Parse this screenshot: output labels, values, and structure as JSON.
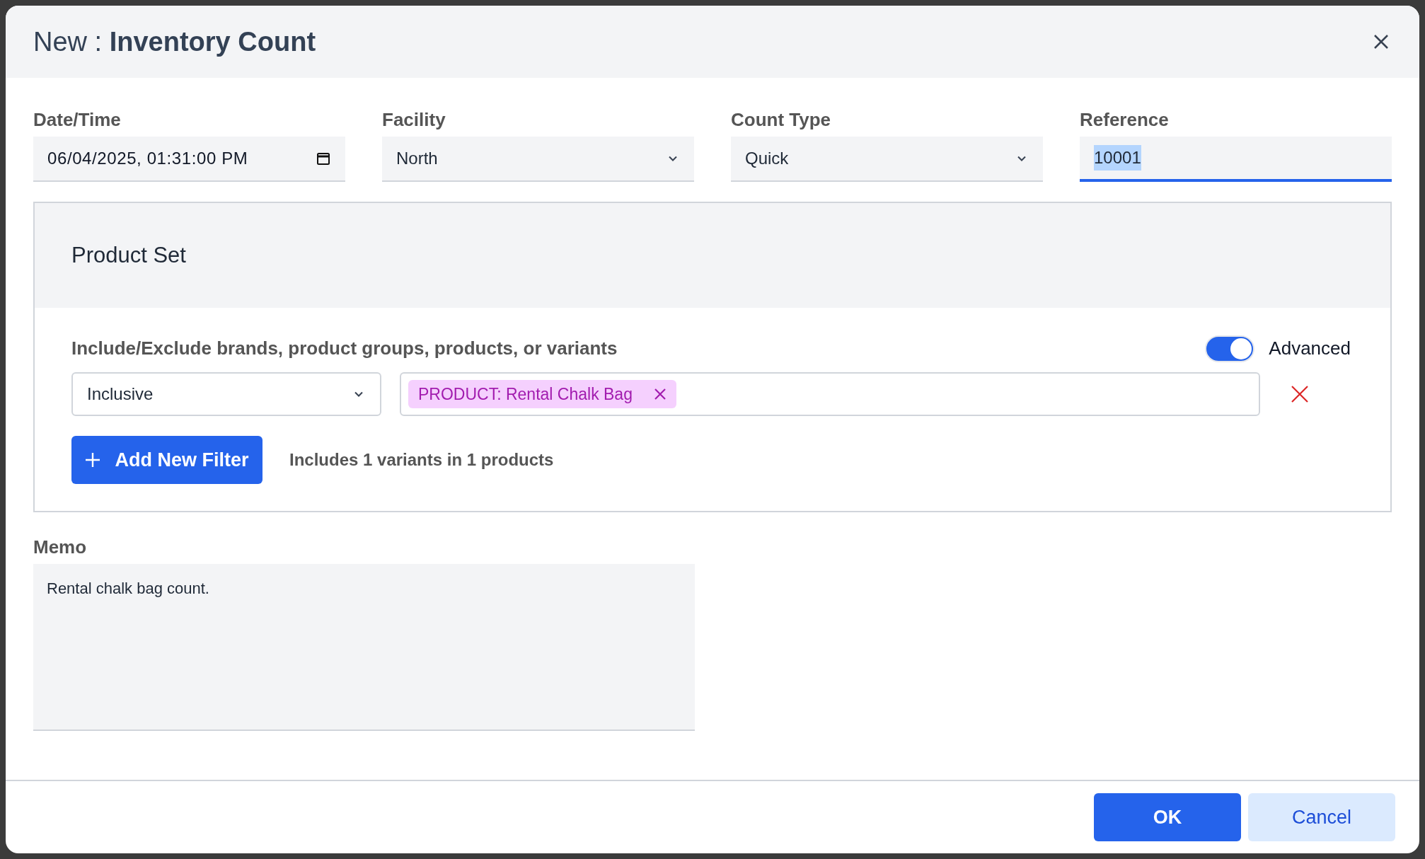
{
  "dialog": {
    "title_prefix": "New :",
    "title": "Inventory Count"
  },
  "fields": [
    {
      "kind": "datetime",
      "label": "Date/Time",
      "value": "06/04/2025, 01:31:00  PM",
      "focused": false
    },
    {
      "kind": "select",
      "label": "Facility",
      "value": "North",
      "focused": false
    },
    {
      "kind": "select",
      "label": "Count Type",
      "value": "Quick",
      "focused": false
    },
    {
      "kind": "text",
      "label": "Reference",
      "value": "10001",
      "focused": true
    }
  ],
  "product_set": {
    "title": "Product Set",
    "filter_label": "Include/Exclude brands, product groups, products, or variants",
    "advanced": {
      "label": "Advanced",
      "on": true
    },
    "filters": [
      {
        "mode": "Inclusive",
        "tags": [
          {
            "text": "PRODUCT: Rental Chalk Bag"
          }
        ]
      }
    ],
    "add_button": "Add New Filter",
    "summary": "Includes 1 variants in 1 products"
  },
  "memo": {
    "label": "Memo",
    "value": "Rental chalk bag count."
  },
  "buttons": [
    {
      "kind": "primary",
      "label": "OK"
    },
    {
      "kind": "secondary",
      "label": "Cancel"
    }
  ]
}
